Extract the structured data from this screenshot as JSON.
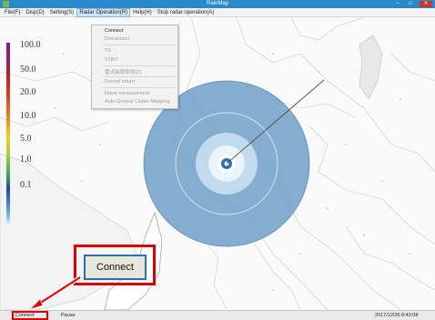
{
  "window": {
    "title": "RainMap"
  },
  "menubar": {
    "items": [
      "File(F)",
      "Disp(D)",
      "Setting(S)",
      "Radar Operation(R)",
      "Help(H)",
      "Stop radar operation(A)"
    ],
    "open_index": 3
  },
  "radar_menu": {
    "items": [
      {
        "label": "Connect",
        "enabled": true
      },
      {
        "label": "Disconnect",
        "enabled": false
      },
      {
        "label": "TX",
        "enabled": false
      },
      {
        "label": "STBY",
        "enabled": false
      },
      {
        "label": "雲点強度取得(Z)",
        "enabled": false
      },
      {
        "label": "Forced return",
        "enabled": false
      },
      {
        "label": "Noise measurement",
        "enabled": false
      },
      {
        "label": "Auto Ground Clutter Mapping",
        "enabled": false
      }
    ]
  },
  "legend": {
    "labels": [
      "100.0",
      "50.0",
      "20.0",
      "10.0",
      "5.0",
      "1.0",
      "0.1"
    ]
  },
  "callout": {
    "label": "Connect"
  },
  "status": {
    "connection": "Connect",
    "state": "Pause",
    "timestamp": "2017/12/26 8:42:08"
  },
  "colors": {
    "titlebar": "#2a8ac9",
    "radar_fill": "#6f9fc7",
    "highlight": "#e10000",
    "accent": "#2b6fb8"
  },
  "icons": {
    "app": "app-icon",
    "minimize": "minimize-icon",
    "maximize": "maximize-icon",
    "close": "close-icon"
  }
}
